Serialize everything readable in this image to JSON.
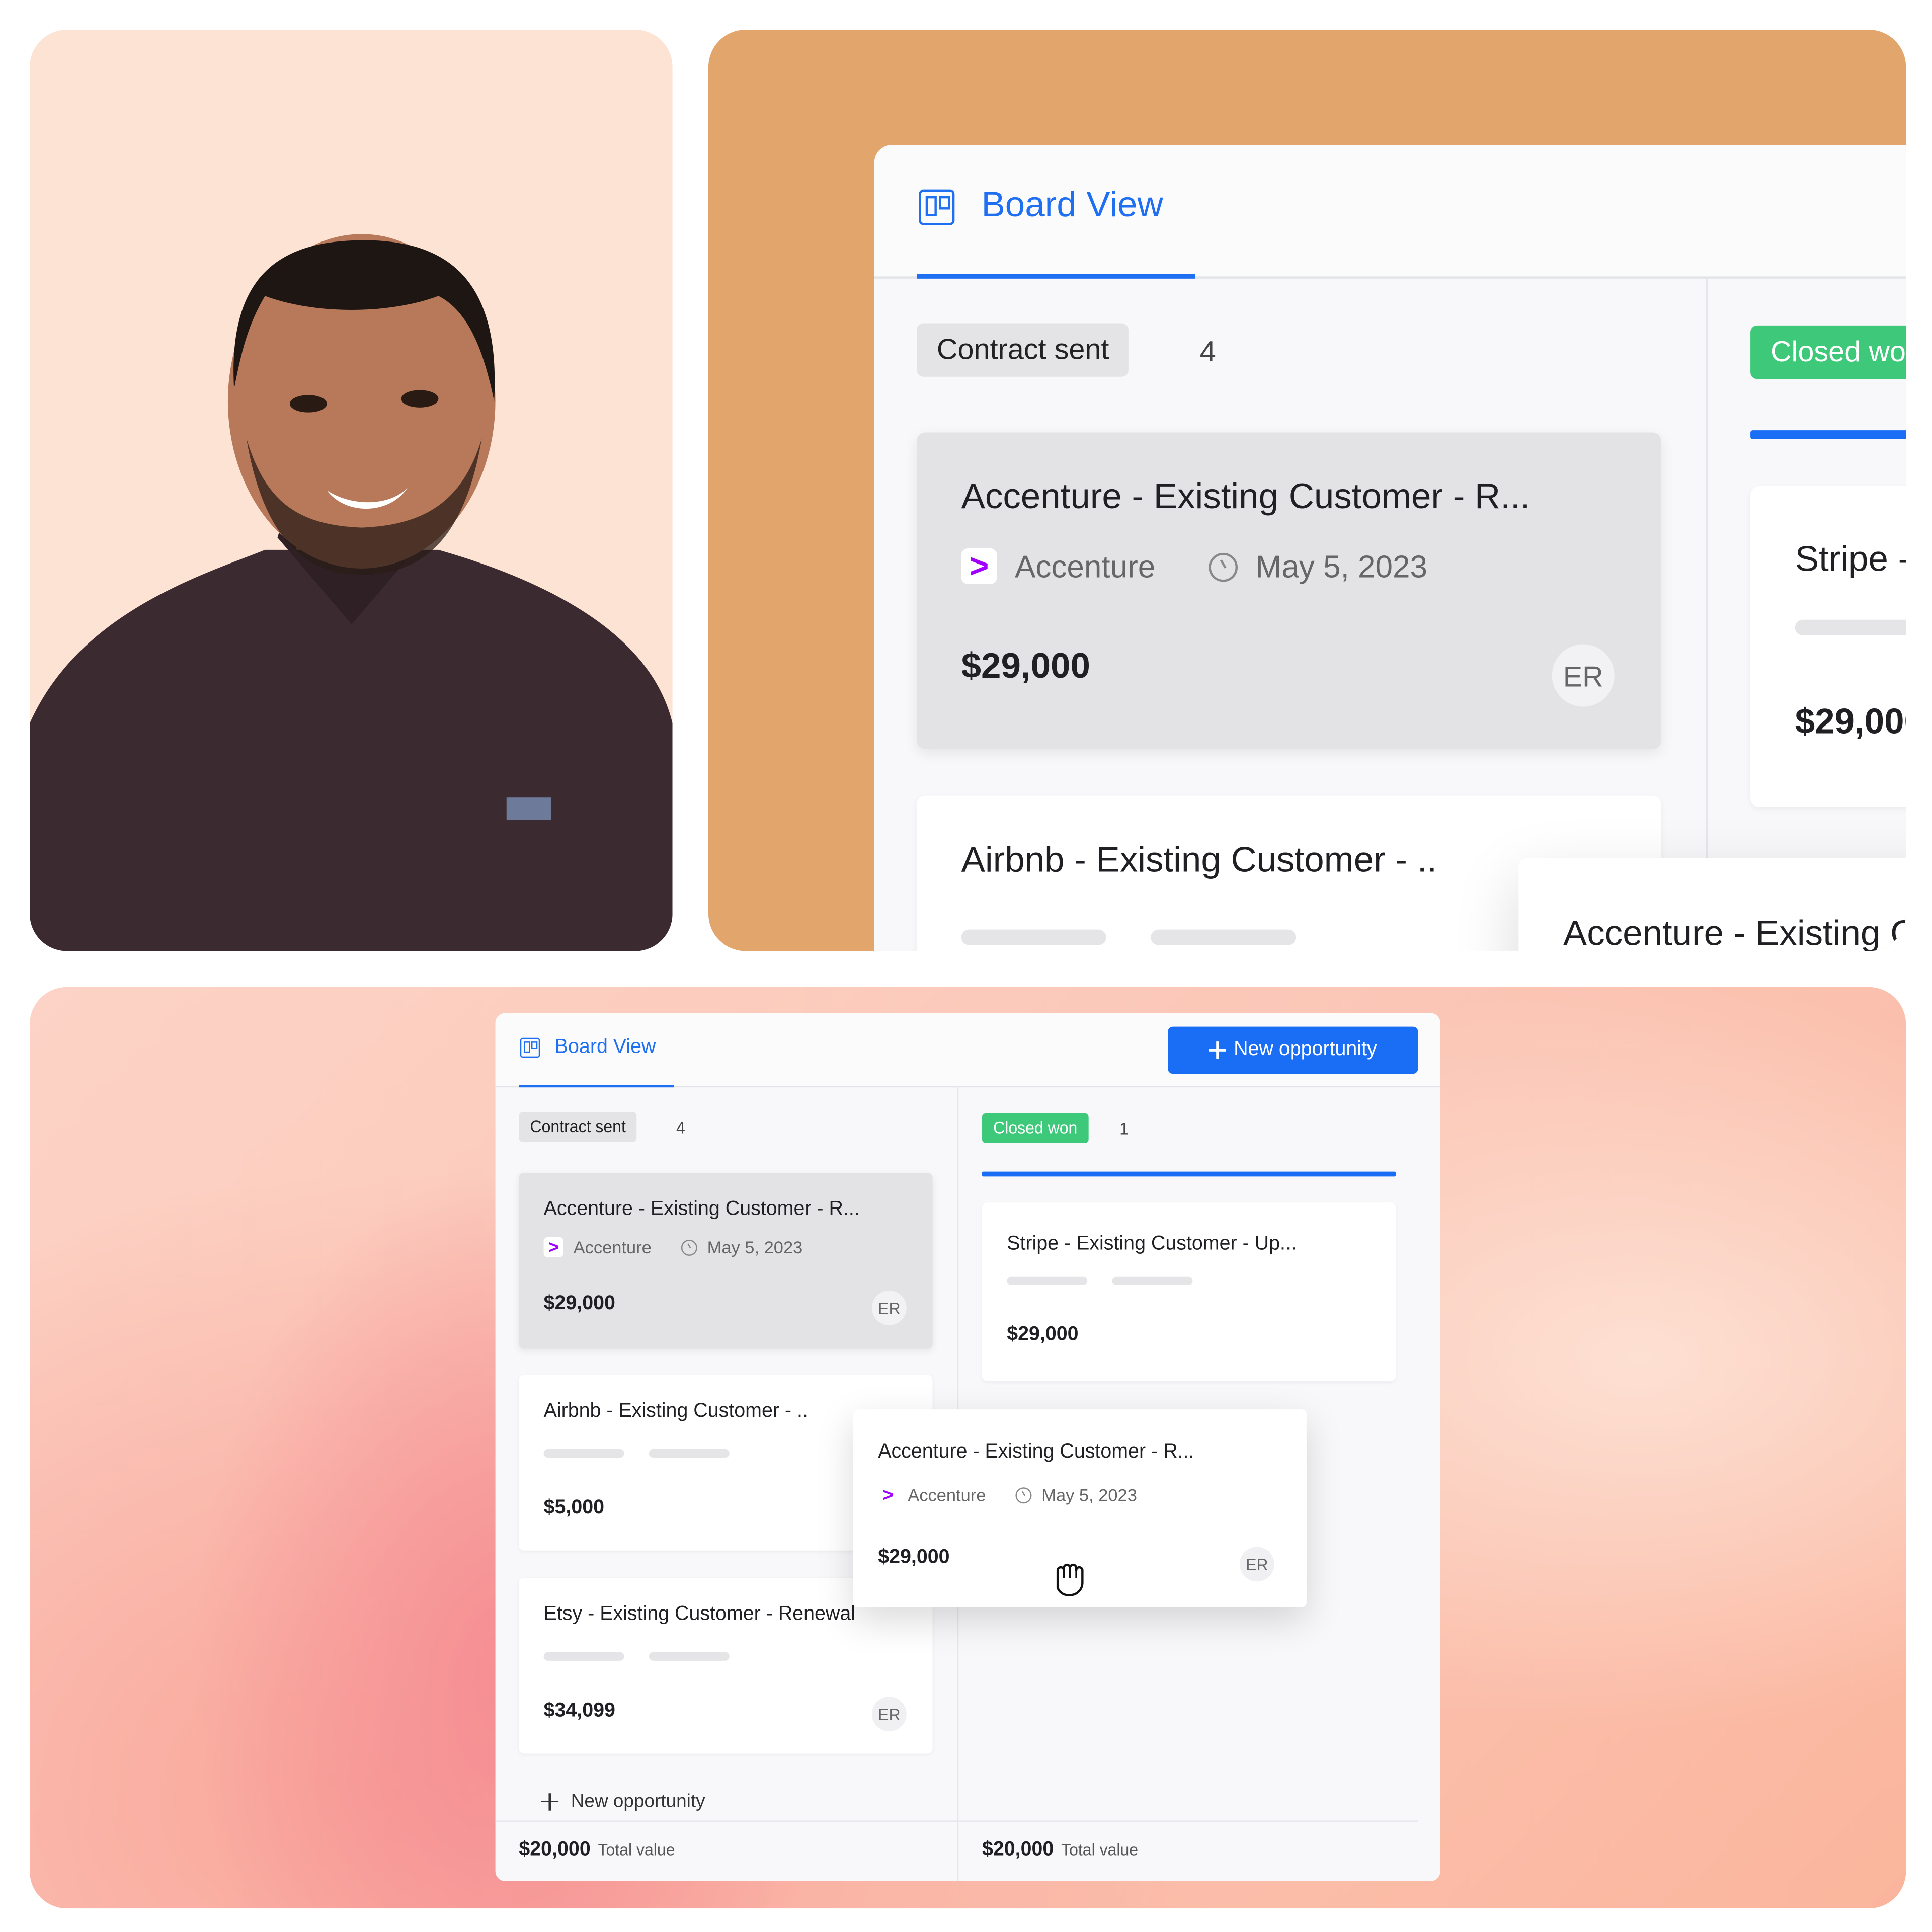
{
  "colors": {
    "accent": "#1a6ef5",
    "closed_won": "#3ec97a",
    "accenture_logo": "#a100ff",
    "photo_bg": "#fde3d4",
    "zoom_bg": "#e2a66c"
  },
  "board": {
    "tab_label": "Board View",
    "new_button_label": "New opportunity",
    "columns": [
      {
        "status": "Contract sent",
        "count": "4",
        "cards": [
          {
            "title": "Accenture - Existing Customer - R...",
            "company": "Accenture",
            "date": "May 5, 2023",
            "amount": "$29,000",
            "owner": "ER"
          },
          {
            "title": "Airbnb - Existing Customer - ..",
            "amount": "$5,000"
          },
          {
            "title": "Etsy - Existing Customer - Renewal",
            "amount": "$34,099",
            "owner": "ER"
          }
        ],
        "add_label": "New opportunity",
        "total": "$20,000",
        "total_label": "Total value"
      },
      {
        "status": "Closed won",
        "count": "1",
        "cards": [
          {
            "title": "Stripe - Existing Customer - Up...",
            "amount": "$29,000"
          }
        ],
        "total": "$20,000",
        "total_label": "Total value"
      }
    ],
    "dragging_card": {
      "title": "Accenture - Existing Customer - R...",
      "company": "Accenture",
      "date": "May 5, 2023",
      "amount": "$29,000",
      "owner": "ER",
      "cursor": "grab-hand-icon"
    }
  }
}
